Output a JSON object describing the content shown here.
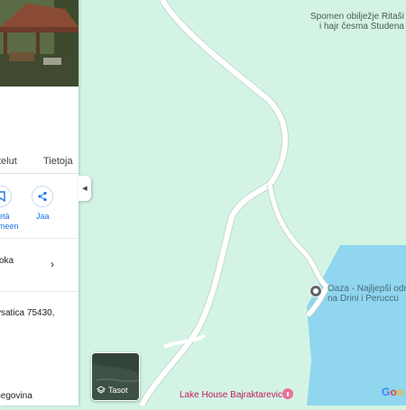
{
  "place_panel": {
    "tabs": {
      "reviews": "telut",
      "about": "Tietoja"
    },
    "actions": {
      "save_line1": "etä",
      "save_line2": "meen",
      "share": "Jaa"
    },
    "row_text": "oka",
    "address": "vsatica 75430,",
    "country": "tsegovina"
  },
  "map": {
    "poi_spomen_line1": "Spomen obilježje Ritaši",
    "poi_spomen_line2": "i hajr česma Studena",
    "poi_oaza_line1": "Oaza - Najljepši odm",
    "poi_oaza_line2": "na Drini i Peruccu",
    "poi_lake_house": "Lake House Bajraktarevic",
    "lake_house_icon": "hotel-icon",
    "layers_label": "Tasot",
    "google_logo": "Goo",
    "colors": {
      "land": "#d3f4e4",
      "water": "#8fd6ee",
      "road": "#ffffff",
      "brand_blue": "#1a73e8"
    }
  }
}
